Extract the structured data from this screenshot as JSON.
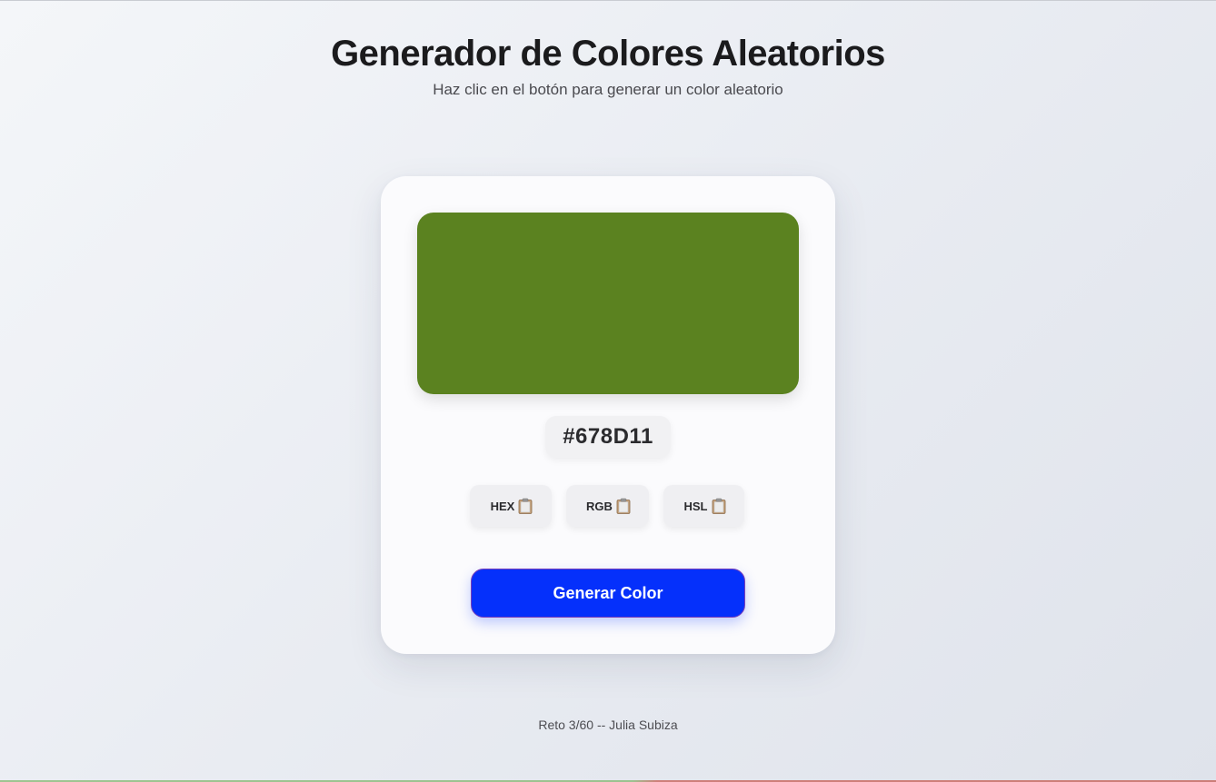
{
  "header": {
    "title": "Generador de Colores Aleatorios",
    "subtitle": "Haz clic en el botón para generar un color aleatorio"
  },
  "color": {
    "current_hex": "#678D11",
    "swatch_color": "#5B8220"
  },
  "copy_buttons": [
    {
      "label": "HEX",
      "icon": "clipboard-icon"
    },
    {
      "label": "RGB",
      "icon": "clipboard-icon"
    },
    {
      "label": "HSL",
      "icon": "clipboard-icon"
    }
  ],
  "generate_button": {
    "label": "Generar Color",
    "color": "#0530FB"
  },
  "footer": {
    "text": "Reto 3/60 -- Julia Subiza"
  }
}
